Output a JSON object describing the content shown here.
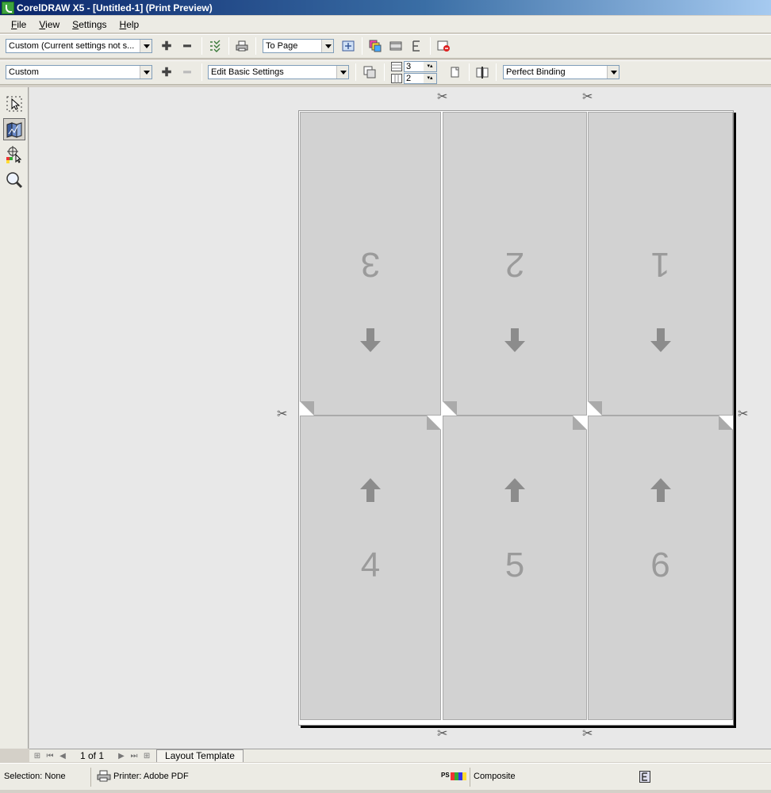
{
  "window": {
    "title": "CorelDRAW X5 - [Untitled-1] (Print Preview)"
  },
  "menu": [
    "File",
    "View",
    "Settings",
    "Help"
  ],
  "toolbar1": {
    "print_style": "Custom (Current settings not s...",
    "zoom": "To Page"
  },
  "toolbar2": {
    "preset": "Custom",
    "edit_settings": "Edit Basic Settings",
    "pages_across": "3",
    "pages_down": "2",
    "binding": "Perfect Binding"
  },
  "tools": [
    "pick-tool-icon",
    "imposition-layout-tool-icon",
    "marks-placement-tool-icon",
    "zoom-tool-icon"
  ],
  "layout": {
    "top_row": [
      "3",
      "2",
      "1"
    ],
    "bottom_row": [
      "4",
      "5",
      "6"
    ]
  },
  "pagebar": {
    "page_counter": "1 of 1",
    "tab_label": "Layout Template"
  },
  "status": {
    "selection": "Selection: None",
    "printer": "Printer: Adobe PDF",
    "mode": "Composite"
  }
}
